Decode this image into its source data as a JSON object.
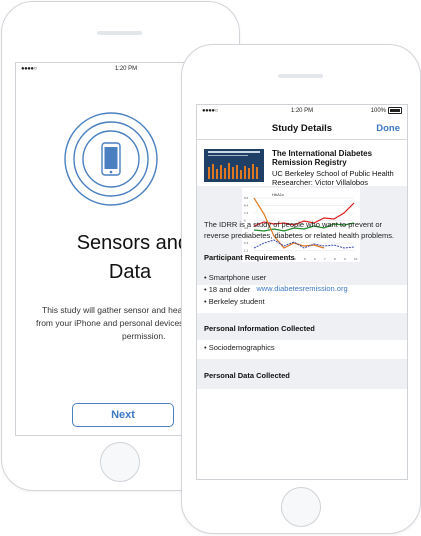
{
  "status_bar": {
    "signal": "●●●●○",
    "time": "1:20 PM",
    "battery_label": "100%"
  },
  "screen_one": {
    "title": "Sensors and Health Data",
    "title_line1": "Sensors and Hea",
    "title_line2": "Data",
    "description_lines": [
      "This study will gather sensor and health d",
      "from your iPhone and personal devices with",
      "permission."
    ],
    "next_label": "Next",
    "icon": "phone-signal-icon"
  },
  "screen_two": {
    "nav_title": "Study Details",
    "done_label": "Done",
    "study_title": "The International Diabetes Remission Registry",
    "institution": "UC Berkeley School of Public Health",
    "researcher": "Researcher: Victor Villalobos",
    "link": "www.diabetesremission.org",
    "description": "The IDRR is a study of people who want to prevent or reverse prediabetes, diabetes or related health problems.",
    "sections": [
      {
        "title": "Participant Requirements",
        "items": [
          "Smartphone user",
          "18 and older",
          "Berkeley student"
        ]
      },
      {
        "title": "Personal Information Collected",
        "items": [
          "Sociodemographics"
        ]
      },
      {
        "title": "Personal Data Collected",
        "items": []
      }
    ],
    "chart_label": "HbA1c",
    "chart_y_ticks": [
      "9.6",
      "8.4",
      "7.2",
      "6",
      "4.8",
      "3.6",
      "2.4",
      "1.2"
    ],
    "chart_x_ticks": [
      "0",
      "1",
      "2",
      "3",
      "4",
      "5",
      "6",
      "7",
      "8",
      "9",
      "10"
    ]
  },
  "colors": {
    "accent": "#3d78c4",
    "section_bg": "#eff0f3",
    "chart_red": "#e02020",
    "chart_green": "#1f8a2a",
    "chart_orange": "#e07820",
    "chart_blue": "#3a4aa8",
    "thumb_bg": "#1f3f66"
  }
}
